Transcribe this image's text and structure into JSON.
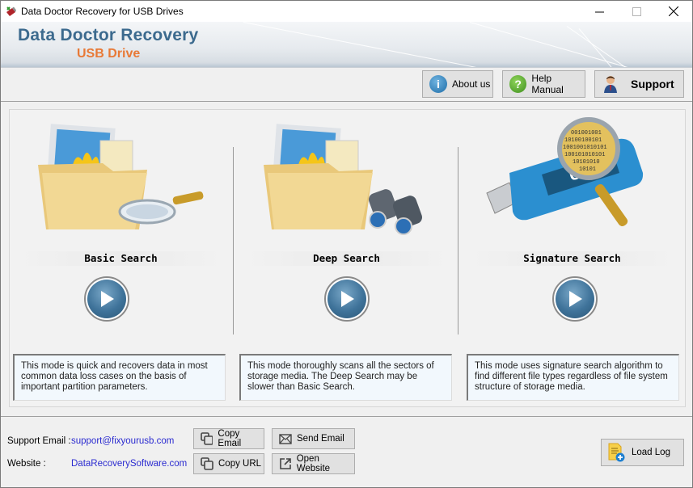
{
  "window": {
    "title": "Data Doctor Recovery for USB Drives",
    "controls": {
      "minimize": "—",
      "maximize": "☐",
      "close": "✕"
    }
  },
  "banner": {
    "title": "Data Doctor Recovery",
    "subtitle": "USB Drive",
    "title_color": "#3c6a8e",
    "subtitle_color": "#e87936"
  },
  "toolbar": {
    "about_label": "About us",
    "about_icon": "i",
    "help_label": "Help Manual",
    "help_icon": "?",
    "support_label": "Support"
  },
  "modes": [
    {
      "title": "Basic Search",
      "illustration": "folder-with-magnifier",
      "description": "This mode is quick and recovers data in most common data loss cases on the basis of important partition parameters."
    },
    {
      "title": "Deep Search",
      "illustration": "folder-with-binoculars",
      "description": "This mode thoroughly scans all the sectors of storage media. The Deep Search may be slower than Basic Search."
    },
    {
      "title": "Signature Search",
      "illustration": "usb-drive-with-magnifier",
      "usb_text": "USB",
      "binary_text": [
        "001001001",
        "10100100101",
        "1001001010101",
        "100101010101",
        "10101010",
        "10101"
      ],
      "description": "This mode uses signature search algorithm to find different file types regardless of file system structure of storage media."
    }
  ],
  "footer": {
    "email_label": "Support Email :",
    "email_value": "support@fixyourusb.com",
    "website_label": "Website :",
    "website_value": "DataRecoverySoftware.com",
    "copy_email_label": "Copy Email",
    "send_email_label": "Send Email",
    "copy_url_label": "Copy URL",
    "open_website_label": "Open Website",
    "load_log_label": "Load Log"
  }
}
